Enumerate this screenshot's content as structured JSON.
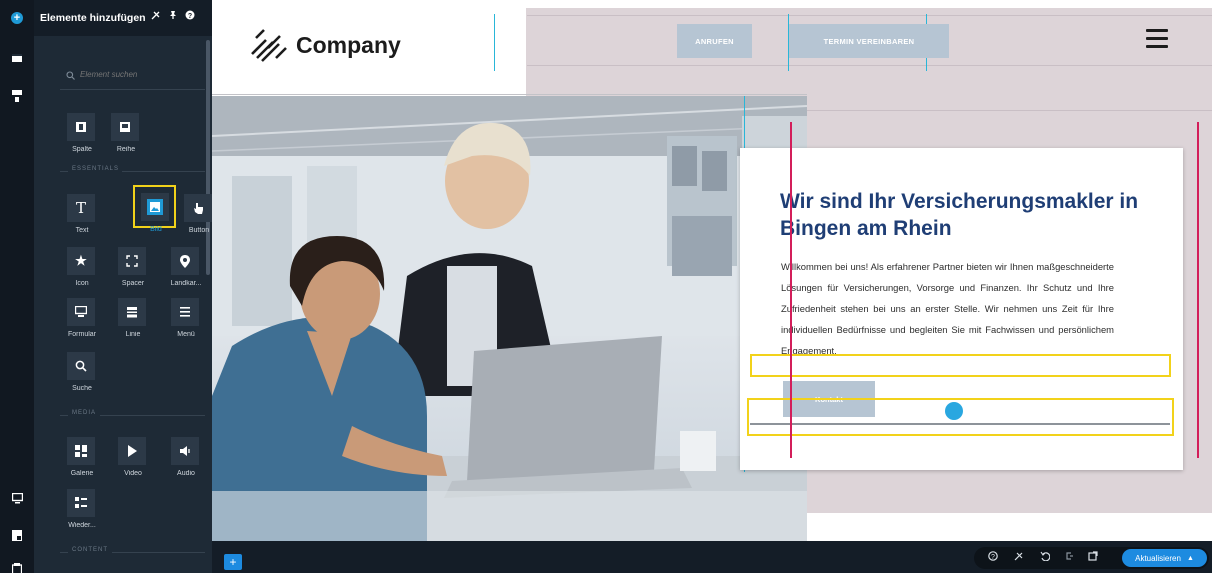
{
  "panel": {
    "title": "Elemente hinzufügen",
    "search_placeholder": "Element suchen",
    "layout_items": [
      {
        "label": "Spalte",
        "icon": "column-icon"
      },
      {
        "label": "Reihe",
        "icon": "row-icon"
      }
    ],
    "sections": {
      "essentials": "ESSENTIALS",
      "media": "MEDIA",
      "content": "CONTENT"
    },
    "essentials_items": [
      {
        "label": "Text",
        "icon": "text-icon"
      },
      {
        "label": "Bild",
        "icon": "image-icon",
        "selected": true
      },
      {
        "label": "Button",
        "icon": "pointer-icon"
      },
      {
        "label": "Icon",
        "icon": "star-icon"
      },
      {
        "label": "Spacer",
        "icon": "spacer-icon"
      },
      {
        "label": "Landkar...",
        "icon": "map-pin-icon"
      },
      {
        "label": "Formular",
        "icon": "form-icon"
      },
      {
        "label": "Linie",
        "icon": "line-icon"
      },
      {
        "label": "Menü",
        "icon": "menu-icon"
      },
      {
        "label": "Suche",
        "icon": "search-icon"
      }
    ],
    "media_items": [
      {
        "label": "Galerie",
        "icon": "gallery-icon"
      },
      {
        "label": "Video",
        "icon": "play-icon"
      },
      {
        "label": "Audio",
        "icon": "audio-icon"
      },
      {
        "label": "Wieder...",
        "icon": "repeater-icon"
      }
    ]
  },
  "site": {
    "logo_text": "Company",
    "nav_call": "ANRUFEN",
    "nav_book": "TERMIN VEREINBAREN",
    "hero_title": "Wir sind Ihr Versicherungsmakler in Bingen am Rhein",
    "hero_text": "Willkommen bei uns! Als erfahrener Partner bieten wir Ihnen maßgeschneiderte Lösungen für Versicherungen, Vorsorge und Finanzen. Ihr Schutz und Ihre Zufriedenheit stehen bei uns an erster Stelle. Wir nehmen uns Zeit für Ihre individuellen Bedürfnisse und begleiten Sie mit Fachwissen und persönlichem Engagement.",
    "hero_button": "Kontakt"
  },
  "bottom_bar": {
    "add_label": "+",
    "update_label": "Aktualisieren"
  },
  "colors": {
    "accent": "#1d8be0",
    "selection": "#f2d21a",
    "guide_cyan": "#29b6d8",
    "guide_pink": "#d31e5a",
    "heading": "#1f3e75"
  }
}
